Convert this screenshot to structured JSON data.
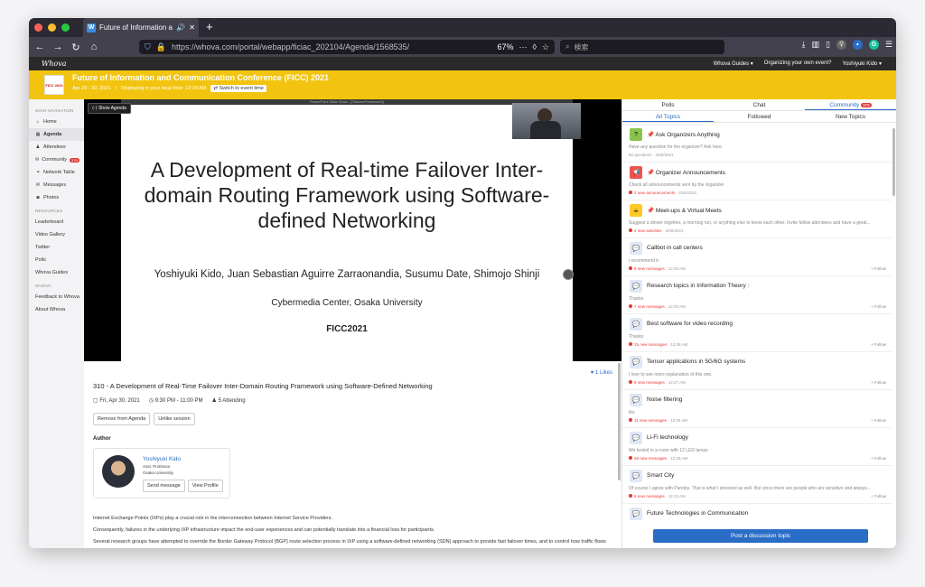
{
  "browser": {
    "tab_title": "Future of Information and Co",
    "url": "https://whova.com/portal/webapp/ficiac_202104/Agenda/1568535/",
    "zoom": "67%",
    "search_placeholder": "検索",
    "colors": {
      "tabbar": "#2b2a33",
      "navbar": "#42414d"
    }
  },
  "app": {
    "logo": "Whova",
    "links": [
      "Whova Guides ▾",
      "Organizing your own event?",
      "Yoshiyuki Kido ▾"
    ]
  },
  "event": {
    "logo_text": "FICC 2021",
    "title": "Future of Information and Communication Conference (FICC) 2021",
    "dates": "Apr 29 - 30, 2021",
    "tz_note": "Displaying in your local time: 12:29 AM",
    "switch_label": "Switch to event time",
    "accent": "#f2c40f"
  },
  "sidebar": {
    "main_header": "MAIN NAVIGATION",
    "main_items": [
      {
        "label": "Home",
        "icon": "home-icon",
        "glyph": "⌂"
      },
      {
        "label": "Agenda",
        "icon": "calendar-icon",
        "glyph": "▦",
        "active": true
      },
      {
        "label": "Attendees",
        "icon": "people-icon",
        "glyph": "♟"
      },
      {
        "label": "Community",
        "icon": "chat-icon",
        "glyph": "✉",
        "badge": "379"
      },
      {
        "label": "Network Table",
        "icon": "link-icon",
        "glyph": "⚭"
      },
      {
        "label": "Messages",
        "icon": "envelope-icon",
        "glyph": "✉"
      },
      {
        "label": "Photos",
        "icon": "camera-icon",
        "glyph": "◙"
      }
    ],
    "resources_header": "RESOURCES",
    "resource_items": [
      "Leaderboard",
      "Video Gallery",
      "Twitter",
      "Polls",
      "Whova Guides"
    ],
    "whova_header": "WHOVA",
    "whova_items": [
      "Feedback to Whova",
      "About Whova"
    ]
  },
  "video": {
    "window_label": "PowerPoint Slide Show - [FailoverFramework]",
    "show_agenda": "Show Agenda",
    "slide_title": "A Development of Real-time Failover Inter-domain Routing Framework using Software-defined Networking",
    "slide_authors": "Yoshiyuki Kido, Juan Sebastian Aguirre Zarraonandia, Susumu Date, Shimojo Shinji",
    "slide_affiliation": "Cybermedia Center, Osaka University",
    "slide_conf": "FICC2021"
  },
  "session": {
    "likes": "1 Likes",
    "title": "310 - A Development of Real-Time Failover Inter-Domain Routing Framework using Software-Defined Networking",
    "date": "Fri, Apr 30, 2021",
    "time": "9:30 PM - 11:00 PM",
    "attending": "5 Attending",
    "btn_remove": "Remove from Agenda",
    "btn_unlike": "Unlike session",
    "author_label": "Author",
    "author": {
      "name": "Yoshiyuki Kido",
      "role": "Asst. Professor",
      "org": "Osaka University",
      "btn_message": "Send message",
      "btn_profile": "View Profile"
    },
    "abstract": [
      "Internet Exchange Points (IXPs) play a crucial role in the interconnection between Internet Service Providers.",
      "Consequently, failures in the underlying IXP infrastructure impact the end-user experiences and can potentially translate into a financial loss for participants.",
      "Several research groups have attempted to override the Border Gateway Protocol (BGP) route selection process in IXP using a software-defined networking (SDN) approach to provide fast failover times, and to control how traffic flows"
    ]
  },
  "right_panel": {
    "tabs": [
      "Polls",
      "Chat",
      "Community"
    ],
    "community_badge": "379",
    "subtabs": [
      "All Topics",
      "Followed",
      "New Topics"
    ],
    "topics": [
      {
        "title": "Ask Organizers Anything",
        "pinned": true,
        "icon": "question-icon",
        "glyph": "?",
        "bg": "#8bc34a",
        "preview": "Have any question for the organizer? Ask here.",
        "meta": "90 questions",
        "date": "4/30/2021",
        "new": false
      },
      {
        "title": "Organizer Announcements",
        "pinned": true,
        "icon": "megaphone-icon",
        "glyph": "📢",
        "bg": "#ef5350",
        "preview": "Check all announcements sent by the organizer",
        "meta": "2 new announcements",
        "date": "4/30/2021",
        "new": true
      },
      {
        "title": "Meet-ups & Virtual Meets",
        "pinned": true,
        "icon": "meetup-icon",
        "glyph": "☕",
        "bg": "#ffca28",
        "preview": "Suggest a dinner together, a morning run, or anything else to know each other. Invite fellow attendees and have a great...",
        "meta": "4 new activities",
        "date": "4/30/2021",
        "new": true
      },
      {
        "title": "Callbot in call centers",
        "pinned": false,
        "icon": "chat-bubble-icon",
        "glyph": "💬",
        "bg": "#dfe8f5",
        "preview": "i recommend it",
        "meta": "8 new messages",
        "date": "12:29 AM",
        "new": true,
        "follow": "+ Follow"
      },
      {
        "title": "Research topics in Information Theory :",
        "pinned": false,
        "icon": "chat-bubble-icon",
        "glyph": "💬",
        "bg": "#dfe8f5",
        "preview": "Thanks",
        "meta": "7 new messages",
        "date": "12:29 AM",
        "new": true,
        "follow": "+ Follow"
      },
      {
        "title": "Best software for video recording",
        "pinned": false,
        "icon": "chat-bubble-icon",
        "glyph": "💬",
        "bg": "#dfe8f5",
        "preview": "Thanks",
        "meta": "15 new messages",
        "date": "12:28 AM",
        "new": true,
        "follow": "+ Follow"
      },
      {
        "title": "Tensor applications in 5G/6G systems",
        "pinned": false,
        "icon": "chat-bubble-icon",
        "glyph": "💬",
        "bg": "#dfe8f5",
        "preview": "I love to see more explanation of this one.",
        "meta": "8 new messages",
        "date": "12:27 AM",
        "new": true,
        "follow": "+ Follow"
      },
      {
        "title": "Noise filtering",
        "pinned": false,
        "icon": "chat-bubble-icon",
        "glyph": "💬",
        "bg": "#dfe8f5",
        "preview": "thx",
        "meta": "11 new messages",
        "date": "12:26 AM",
        "new": true,
        "follow": "+ Follow"
      },
      {
        "title": "Li-Fi technology",
        "pinned": false,
        "icon": "chat-bubble-icon",
        "glyph": "💬",
        "bg": "#dfe8f5",
        "preview": "We tested in a room with 12 LED lamps",
        "meta": "26 new messages",
        "date": "12:25 AM",
        "new": true,
        "follow": "+ Follow"
      },
      {
        "title": "Smart City",
        "pinned": false,
        "icon": "chat-bubble-icon",
        "glyph": "💬",
        "bg": "#dfe8f5",
        "preview": "Of course I agree with Pandey. That is what I stressed as well. But since there are people who are sensitive and always...",
        "meta": "6 new messages",
        "date": "12:23 AM",
        "new": true,
        "follow": "+ Follow"
      },
      {
        "title": "Future Technologies in Communication",
        "pinned": false,
        "icon": "chat-bubble-icon",
        "glyph": "💬",
        "bg": "#dfe8f5",
        "preview": "",
        "meta": "",
        "date": "",
        "new": false
      }
    ],
    "post_button": "Post a discussion topic"
  }
}
